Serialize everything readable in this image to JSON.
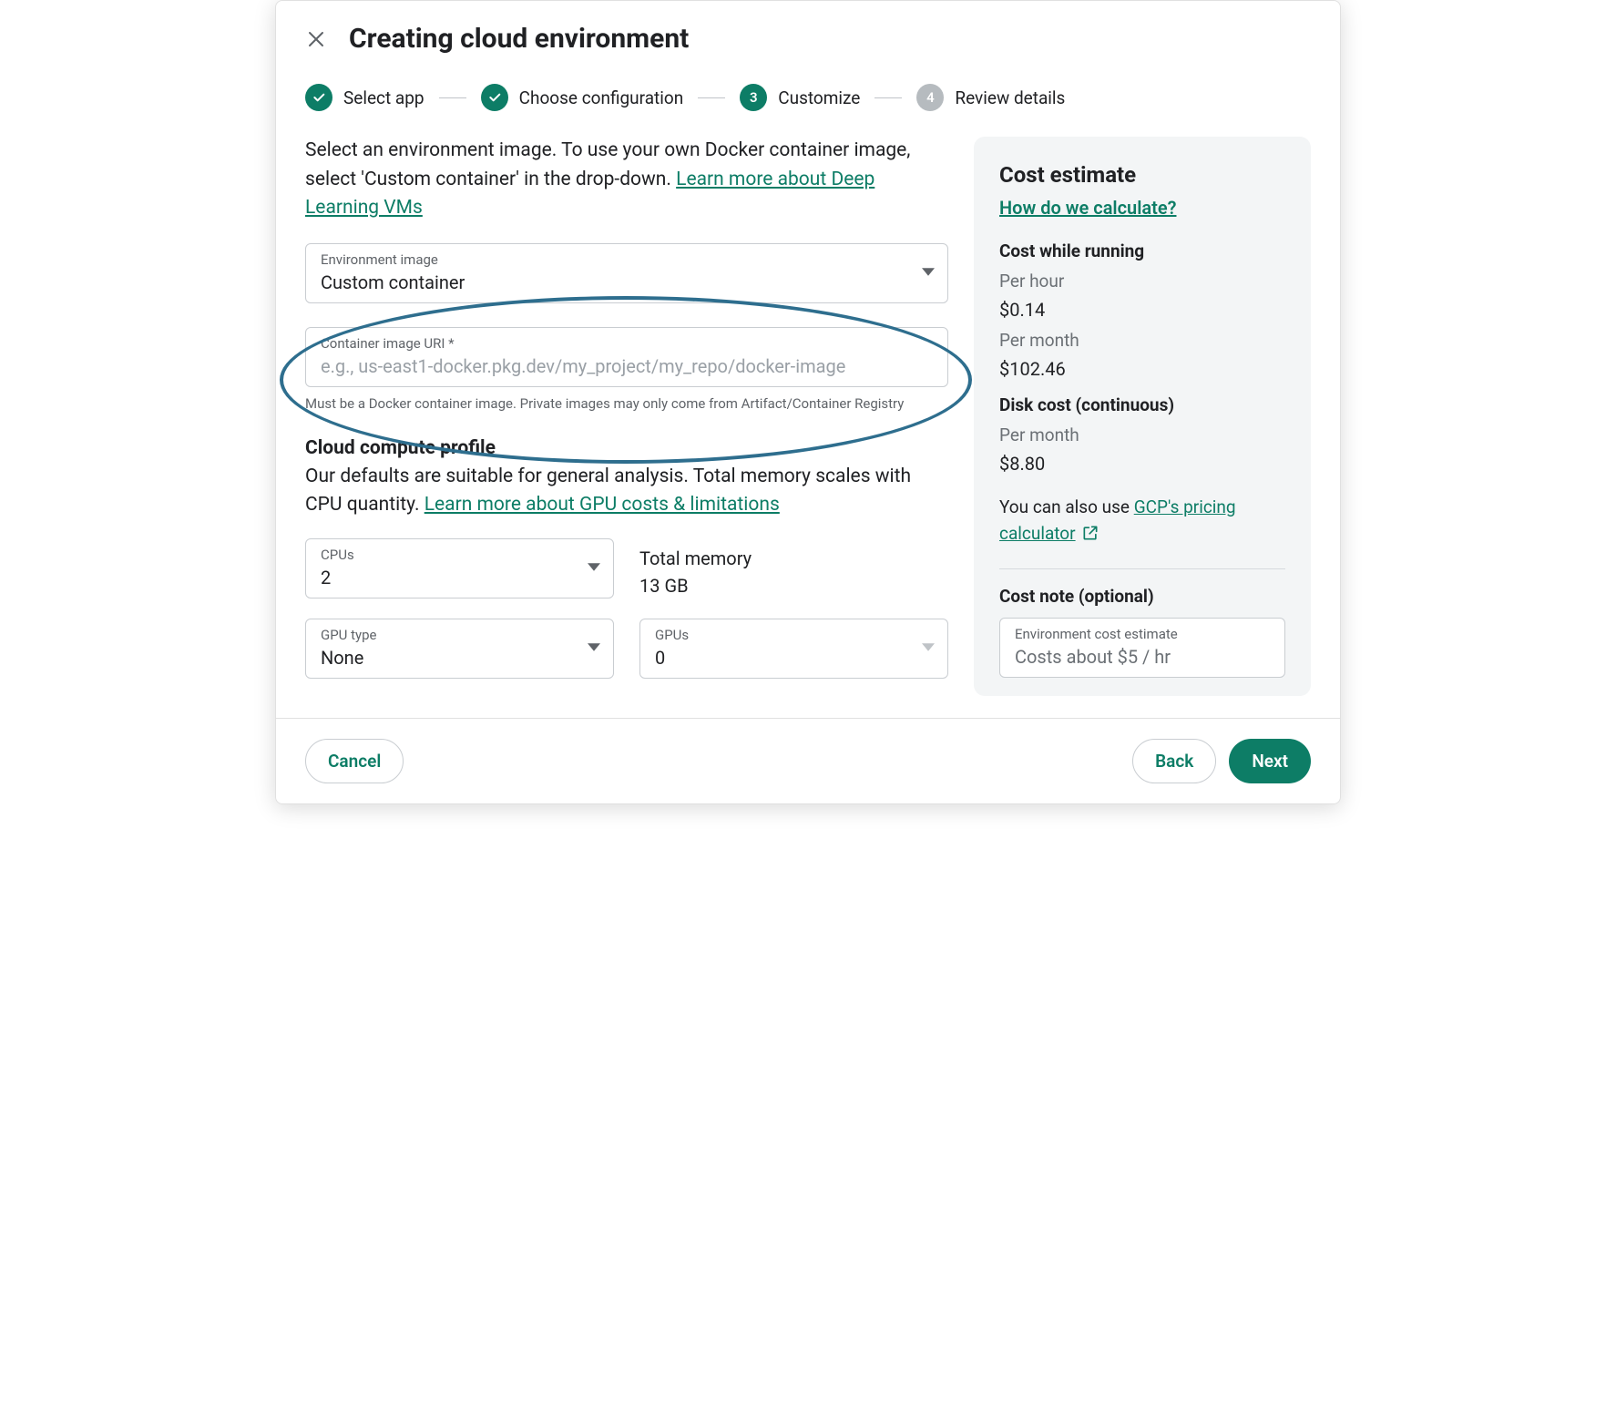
{
  "header": {
    "title": "Creating cloud environment"
  },
  "stepper": {
    "steps": [
      {
        "label": "Select app",
        "state": "done"
      },
      {
        "label": "Choose configuration",
        "state": "done"
      },
      {
        "label": "Customize",
        "state": "current",
        "num": "3"
      },
      {
        "label": "Review details",
        "state": "future",
        "num": "4"
      }
    ]
  },
  "main": {
    "intro_pre": "Select an environment image. To use your own Docker container image, select 'Custom container' in the drop-down. ",
    "intro_link": "Learn more about Deep Learning VMs",
    "env_image": {
      "label": "Environment image",
      "value": "Custom container"
    },
    "uri": {
      "label": "Container image URI *",
      "placeholder": "e.g., us-east1-docker.pkg.dev/my_project/my_repo/docker-image",
      "helper": "Must be a Docker container image. Private images may only come from Artifact/Container Registry"
    },
    "compute": {
      "heading": "Cloud compute profile",
      "sub_pre": "Our defaults are suitable for general analysis. Total memory scales with CPU quantity. ",
      "sub_link": "Learn more about GPU costs & limitations",
      "cpus": {
        "label": "CPUs",
        "value": "2"
      },
      "memory": {
        "label": "Total memory",
        "value": "13 GB"
      },
      "gpu_type": {
        "label": "GPU type",
        "value": "None"
      },
      "gpus": {
        "label": "GPUs",
        "value": "0"
      }
    }
  },
  "side": {
    "title": "Cost estimate",
    "how_link": "How do we calculate?",
    "running_head": "Cost while running",
    "per_hour_label": "Per hour",
    "per_hour_value": "$0.14",
    "per_month_label": "Per month",
    "per_month_value": "$102.46",
    "disk_head": "Disk cost (continuous)",
    "disk_per_month_label": "Per month",
    "disk_per_month_value": "$8.80",
    "note_pre": "You can also use ",
    "note_link": "GCP's pricing calculator",
    "cost_note_head": "Cost note (optional)",
    "cost_note": {
      "label": "Environment cost estimate",
      "value": "Costs about $5 / hr"
    }
  },
  "footer": {
    "cancel": "Cancel",
    "back": "Back",
    "next": "Next"
  }
}
